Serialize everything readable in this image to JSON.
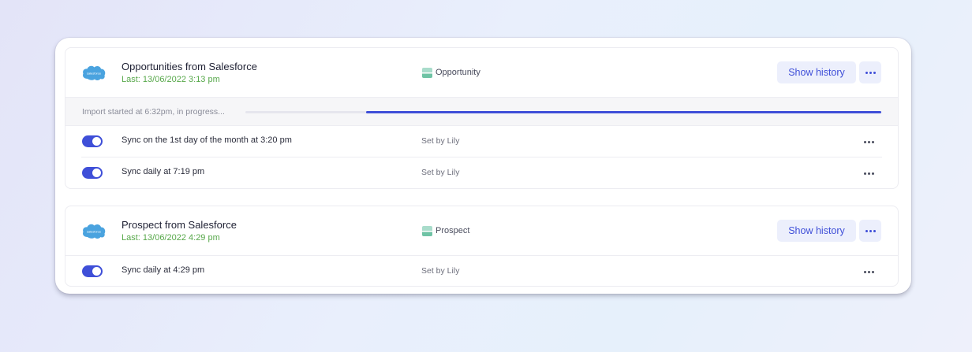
{
  "integrations": [
    {
      "logo_text": "salesforce",
      "title": "Opportunities from Salesforce",
      "last_sync": "Last: 13/06/2022 3:13 pm",
      "object_name": "Opportunity",
      "show_history_label": "Show history",
      "progress_text": "Import started at 6:32pm, in progress...",
      "progress_fraction": 0.81,
      "schedules": [
        {
          "label": "Sync on the 1st day of the month at 3:20 pm",
          "set_by": "Set by Lily",
          "enabled": true
        },
        {
          "label": "Sync daily at 7:19 pm",
          "set_by": "Set by Lily",
          "enabled": true
        }
      ]
    },
    {
      "logo_text": "salesforce",
      "title": "Prospect from Salesforce",
      "last_sync": "Last: 13/06/2022 4:29 pm",
      "object_name": "Prospect",
      "show_history_label": "Show history",
      "schedules": [
        {
          "label": "Sync daily at 4:29 pm",
          "set_by": "Set by Lily",
          "enabled": true
        }
      ]
    }
  ],
  "colors": {
    "accent": "#3f4fd8",
    "success_text": "#57a84a",
    "salesforce_blue": "#4aa3df"
  },
  "icons": {
    "logo": "salesforce-cloud-icon",
    "object": "table-object-icon",
    "more": "more-horizontal-icon"
  }
}
